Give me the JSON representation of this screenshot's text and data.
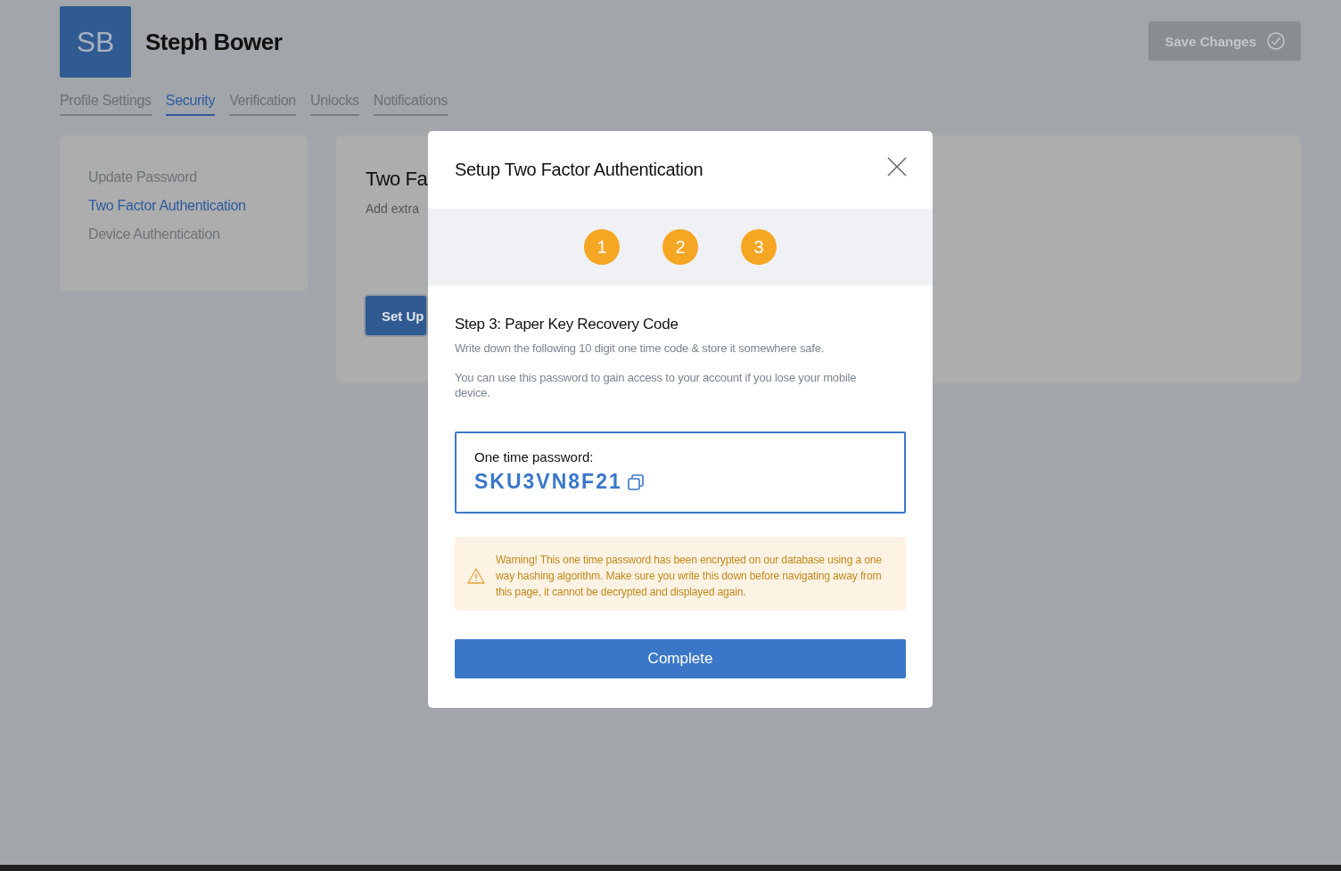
{
  "profile": {
    "initials": "SB",
    "name": "Steph Bower"
  },
  "save_button": {
    "label": "Save Changes",
    "disabled": true
  },
  "tabs": [
    {
      "label": "Profile Settings",
      "selected": false
    },
    {
      "label": "Security",
      "selected": true
    },
    {
      "label": "Verification",
      "selected": false
    },
    {
      "label": "Unlocks",
      "selected": false
    },
    {
      "label": "Notifications",
      "selected": false
    }
  ],
  "sidebar": {
    "items": [
      {
        "label": "Update Password",
        "selected": false
      },
      {
        "label": "Two Factor Authentication",
        "selected": true
      },
      {
        "label": "Device Authentication",
        "selected": false
      }
    ]
  },
  "panel": {
    "title": "Two Fa",
    "description": "Add extra",
    "button": "Set Up"
  },
  "modal": {
    "title": "Setup Two Factor Authentication",
    "steps": [
      {
        "label": "1",
        "active": true
      },
      {
        "label": "2",
        "active": true
      },
      {
        "label": "3",
        "active": true
      }
    ],
    "heading": "Step 3: Paper Key Recovery Code",
    "paragraphs": [
      "Write down the following 10 digit one time code & store it somewhere safe.",
      "You can use this password to gain access to your account if you lose your mobile device."
    ],
    "code_label": "One time password:",
    "code": "SKU3VN8F21",
    "warning": "Warning! This one time password has been encrypted on our database using a one way hashing algorithm. Make sure you write this down before navigating away from this page, it cannot be decrypted and displayed again.",
    "button": "Complete"
  }
}
